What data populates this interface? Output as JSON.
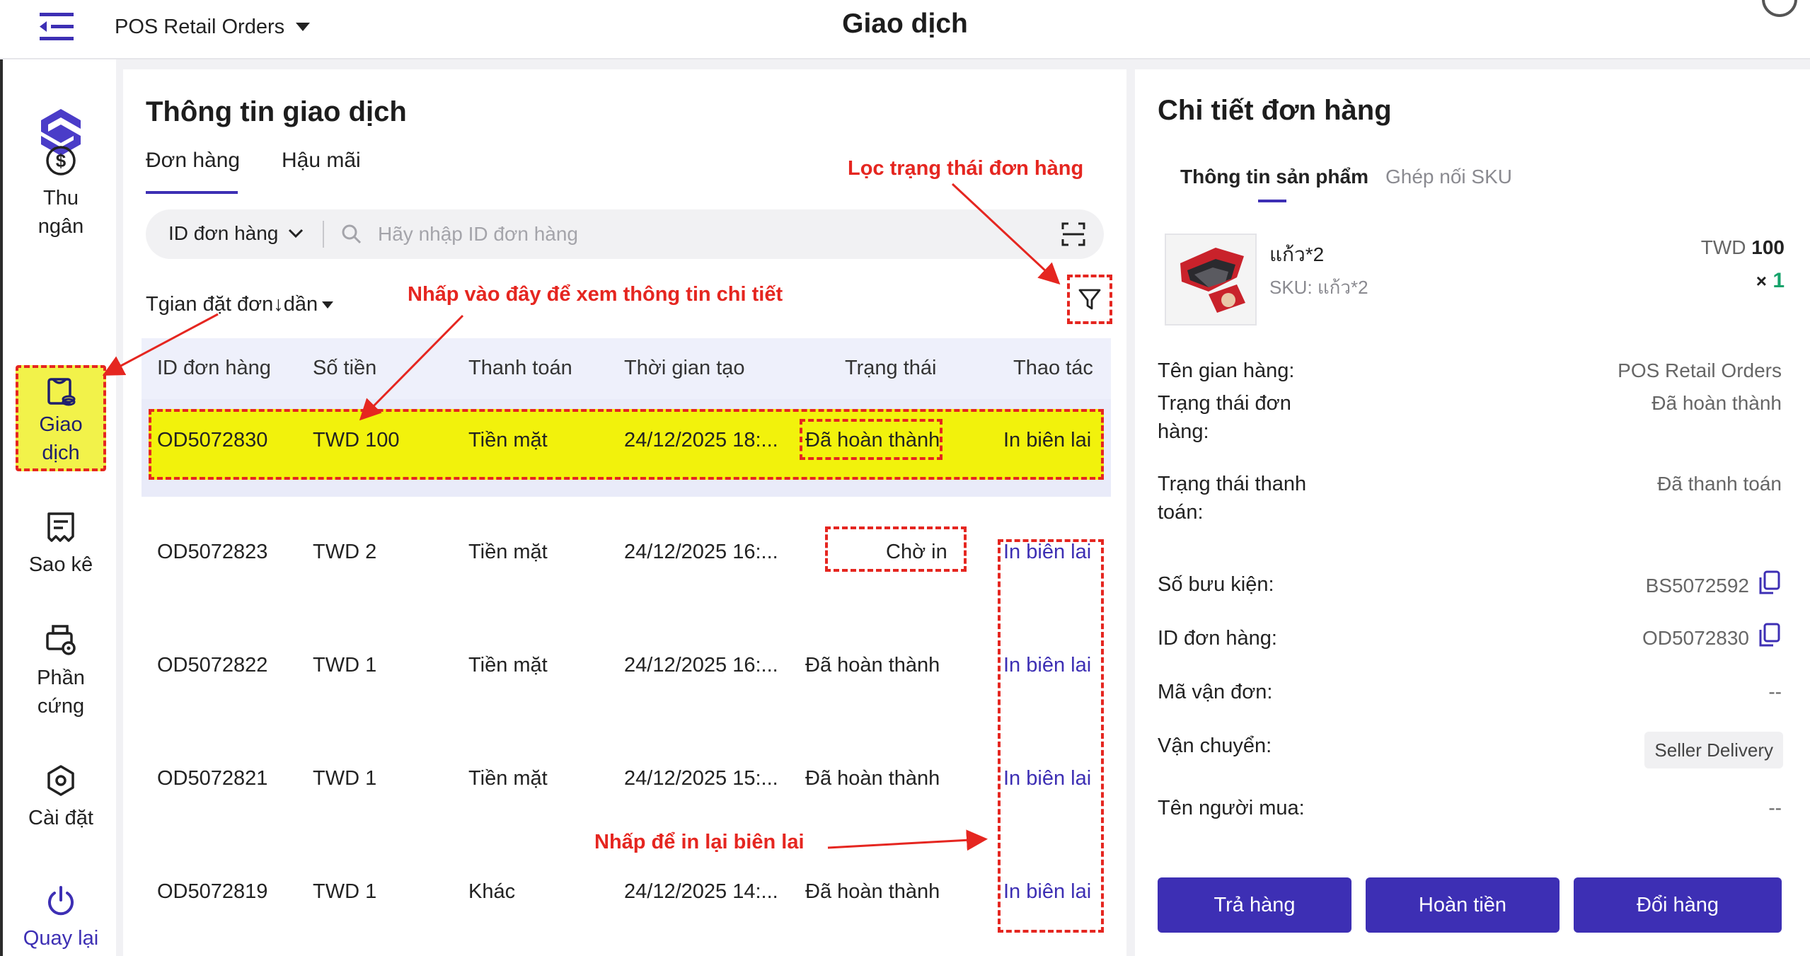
{
  "header": {
    "store": "POS Retail Orders",
    "title": "Giao dịch"
  },
  "sidebar": {
    "items": [
      {
        "label_1": "Thu",
        "label_2": "ngân",
        "icon": "dollar-circle-icon"
      },
      {
        "label_1": "Giao",
        "label_2": "dịch",
        "icon": "receipt-bag-icon"
      },
      {
        "label_1": "Sao kê",
        "icon": "statement-icon"
      },
      {
        "label_1": "Phần",
        "label_2": "cứng",
        "icon": "printer-gear-icon"
      },
      {
        "label_1": "Cài đặt",
        "icon": "settings-hex-icon"
      },
      {
        "label_1": "Quay lại",
        "icon": "power-icon"
      }
    ]
  },
  "left": {
    "title": "Thông tin giao dịch",
    "tabs": [
      "Đơn hàng",
      "Hậu mãi"
    ],
    "search": {
      "type": "ID đơn hàng",
      "placeholder": "Hãy nhập ID đơn hàng"
    },
    "sort": "Tgian đặt đơn↓dần",
    "columns": [
      "ID đơn hàng",
      "Số tiền",
      "Thanh toán",
      "Thời gian tạo",
      "Trạng thái",
      "Thao tác"
    ],
    "rows": [
      {
        "id": "OD5072830",
        "amount": "TWD 100",
        "payment": "Tiền mặt",
        "time": "24/12/2025 18:...",
        "status": "Đã hoàn thành",
        "action": "In biên lai"
      },
      {
        "id": "OD5072823",
        "amount": "TWD 2",
        "payment": "Tiền mặt",
        "time": "24/12/2025 16:...",
        "status": "Chờ in",
        "action": "In biên lai"
      },
      {
        "id": "OD5072822",
        "amount": "TWD 1",
        "payment": "Tiền mặt",
        "time": "24/12/2025 16:...",
        "status": "Đã hoàn thành",
        "action": "In biên lai"
      },
      {
        "id": "OD5072821",
        "amount": "TWD 1",
        "payment": "Tiền mặt",
        "time": "24/12/2025 15:...",
        "status": "Đã hoàn thành",
        "action": "In biên lai"
      },
      {
        "id": "OD5072819",
        "amount": "TWD 1",
        "payment": "Khác",
        "time": "24/12/2025 14:...",
        "status": "Đã hoàn thành",
        "action": "In biên lai"
      }
    ]
  },
  "annotations": {
    "filter": "Lọc trạng thái đơn hàng",
    "detail": "Nhấp vào đây để xem thông tin chi tiết",
    "reprint": "Nhấp để in lại biên lai"
  },
  "right": {
    "title": "Chi tiết đơn hàng",
    "tabs": [
      "Thông tin sản phẩm",
      "Ghép nối SKU"
    ],
    "product": {
      "name": "แก้ว*2",
      "sku": "SKU: แก้ว*2",
      "price_currency": "TWD",
      "price_value": "100",
      "qty_prefix": "×",
      "qty": "1"
    },
    "details": [
      {
        "label": "Tên gian hàng:",
        "value": "POS Retail Orders"
      },
      {
        "label_1": "Trạng thái đơn",
        "label_2": "hàng:",
        "value": "Đã hoàn thành"
      },
      {
        "label_1": "Trạng thái thanh",
        "label_2": "toán:",
        "value": "Đã thanh toán"
      },
      {
        "label": "Số bưu kiện:",
        "value": "BS5072592"
      },
      {
        "label": "ID đơn hàng:",
        "value": "OD5072830"
      },
      {
        "label": "Mã vận đơn:",
        "value": "--"
      },
      {
        "label": "Vận chuyển:",
        "value": "Seller Delivery"
      },
      {
        "label": "Tên người mua:",
        "value": "--"
      }
    ],
    "actions": [
      "Trả hàng",
      "Hoàn tiền",
      "Đổi hàng"
    ]
  },
  "colors": {
    "brand": "#3d2fb4",
    "highlight": "#f2f20c",
    "annotation": "#e52620",
    "qty": "#16a36b"
  }
}
